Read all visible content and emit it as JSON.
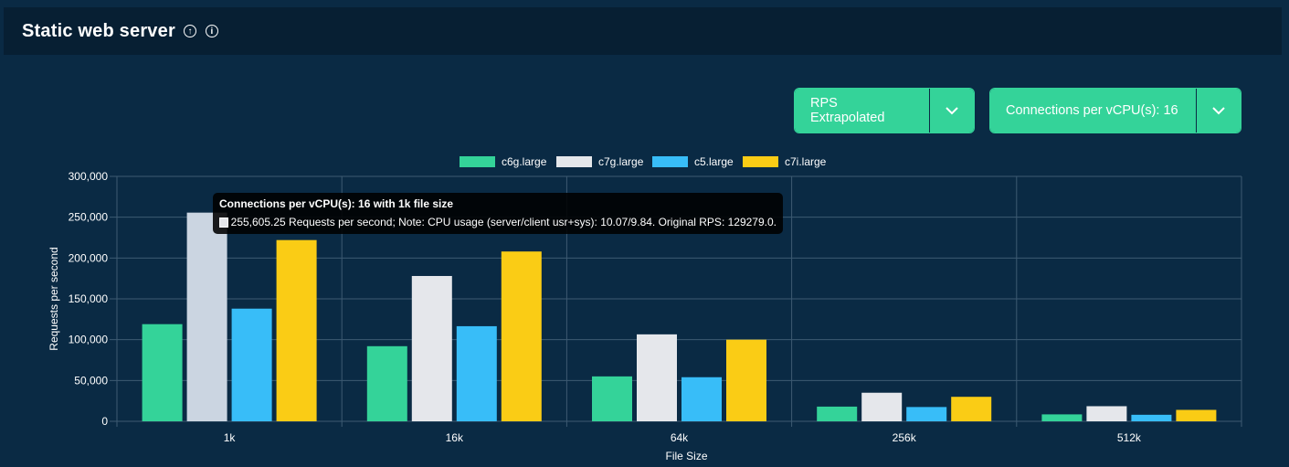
{
  "header": {
    "title": "Static web server",
    "icons": [
      "arrow-up-circle-icon",
      "info-icon"
    ]
  },
  "controls": {
    "metric_dropdown": {
      "label": "RPS Extrapolated",
      "icon": "chevron-down-icon"
    },
    "connections_dropdown": {
      "label": "Connections per vCPU(s): 16",
      "icon": "chevron-down-icon"
    }
  },
  "tooltip": {
    "title": "Connections per vCPU(s): 16 with 1k file size",
    "body": "255,605.25 Requests per second; Note: CPU usage (server/client usr+sys): 10.07/9.84. Original RPS: 129279.0."
  },
  "chart_data": {
    "type": "bar",
    "categories": [
      "1k",
      "16k",
      "64k",
      "256k",
      "512k"
    ],
    "series": [
      {
        "name": "c6g.large",
        "color": "#34d399",
        "values": [
          119000,
          92000,
          55000,
          18000,
          8500
        ]
      },
      {
        "name": "c7g.large",
        "color": "#e5e7eb",
        "values": [
          255605.25,
          178000,
          106500,
          35000,
          18500
        ]
      },
      {
        "name": "c5.large",
        "color": "#38bdf8",
        "values": [
          138000,
          116500,
          54000,
          17500,
          8000
        ]
      },
      {
        "name": "c7i.large",
        "color": "#facc15",
        "values": [
          222000,
          208000,
          100000,
          30000,
          14000
        ]
      }
    ],
    "hover": {
      "series": 1,
      "category": 0,
      "color": "#cbd5e1"
    },
    "yticks": [
      "0",
      "50,000",
      "100,000",
      "150,000",
      "200,000",
      "250,000",
      "300,000"
    ],
    "ylim": [
      0,
      300000
    ],
    "xlabel": "File Size",
    "ylabel": "Requests per second",
    "grid": true,
    "legend_position": "top"
  }
}
